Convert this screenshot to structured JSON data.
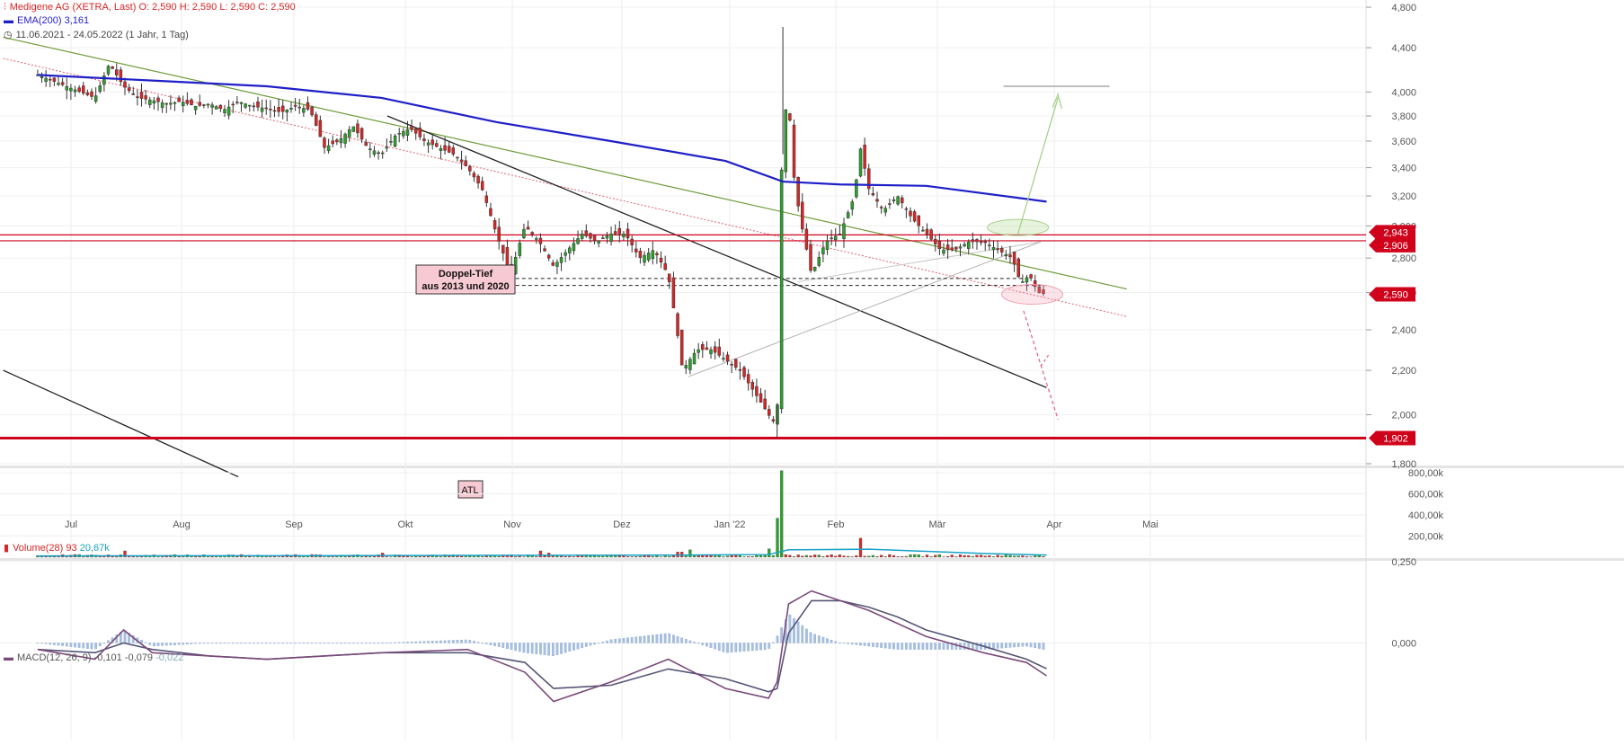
{
  "header": {
    "instrument": "Medigene AG (XETRA, Last)",
    "ohlc": "O: 2,590  H: 2,590  L: 2,590  C: 2,590",
    "ema_label": "EMA(200)",
    "ema_value": "3,161",
    "range": "11.06.2021 - 24.05.2022  (1 Jahr, 1 Tag)"
  },
  "volume_legend": {
    "label": "Volume(28)",
    "v1": "93",
    "v2": "20,67k"
  },
  "macd_legend": {
    "label": "MACD(12, 26, 9)",
    "v1": "-0,101",
    "v2": "-0,079",
    "v3": "-0,022"
  },
  "colors": {
    "up": "#2ca02c",
    "down": "#d62728",
    "ema": "#1f1fc8",
    "trend_green": "#6e9c3a",
    "black_line": "#222222",
    "red_level": "#d0021b",
    "macd": "#7a4a7a",
    "signal": "#555577",
    "hist": "#a8c0e0",
    "volume_ma": "#17a2c8"
  },
  "annotations": {
    "double_bottom_line1": "Doppel-Tief",
    "double_bottom_line2": "aus 2013 und 2020",
    "atl": "ATL"
  },
  "chart_data": [
    {
      "type": "candlestick",
      "title": "Medigene AG (XETRA, Last)",
      "x_months": [
        "Jul",
        "Aug",
        "Sep",
        "Okt",
        "Nov",
        "Dez",
        "Jan '22",
        "Feb",
        "Mär",
        "Apr",
        "Mai"
      ],
      "y_ticks": [
        "4,800",
        "4,400",
        "4,000",
        "3,800",
        "3,600",
        "3,400",
        "3,200",
        "3,000",
        "2,800",
        "2,600",
        "2,400",
        "2,200",
        "2,000",
        "1,800"
      ],
      "y_range": [
        1.8,
        4.8
      ],
      "y_scale": "log",
      "price_markers": [
        "2,943",
        "2,906",
        "2,590",
        "1,902"
      ],
      "support_levels": [
        2.943,
        2.906,
        1.902
      ],
      "close_path": [
        [
          0,
          4.15
        ],
        [
          5,
          4.1
        ],
        [
          10,
          4.05
        ],
        [
          15,
          4.0
        ],
        [
          20,
          3.95
        ],
        [
          25,
          4.25
        ],
        [
          30,
          4.05
        ],
        [
          35,
          3.95
        ],
        [
          40,
          3.93
        ],
        [
          45,
          3.9
        ],
        [
          50,
          3.92
        ],
        [
          55,
          3.88
        ],
        [
          60,
          3.9
        ],
        [
          65,
          3.85
        ],
        [
          70,
          3.92
        ],
        [
          75,
          3.88
        ],
        [
          80,
          3.86
        ],
        [
          85,
          3.83
        ],
        [
          90,
          3.88
        ],
        [
          95,
          3.85
        ],
        [
          100,
          3.55
        ],
        [
          105,
          3.6
        ],
        [
          110,
          3.72
        ],
        [
          115,
          3.55
        ],
        [
          120,
          3.5
        ],
        [
          125,
          3.65
        ],
        [
          130,
          3.7
        ],
        [
          135,
          3.6
        ],
        [
          140,
          3.55
        ],
        [
          145,
          3.5
        ],
        [
          150,
          3.4
        ],
        [
          155,
          3.25
        ],
        [
          160,
          2.95
        ],
        [
          165,
          2.7
        ],
        [
          170,
          3.0
        ],
        [
          175,
          2.9
        ],
        [
          180,
          2.75
        ],
        [
          185,
          2.85
        ],
        [
          190,
          2.95
        ],
        [
          195,
          2.9
        ],
        [
          200,
          2.95
        ],
        [
          205,
          2.95
        ],
        [
          210,
          2.8
        ],
        [
          215,
          2.85
        ],
        [
          220,
          2.7
        ],
        [
          225,
          2.2
        ],
        [
          230,
          2.3
        ],
        [
          235,
          2.3
        ],
        [
          240,
          2.25
        ],
        [
          245,
          2.2
        ],
        [
          250,
          2.1
        ],
        [
          255,
          2.0
        ],
        [
          258,
          1.95
        ],
        [
          260,
          3.8
        ],
        [
          262,
          3.9
        ],
        [
          264,
          3.3
        ],
        [
          266,
          3.05
        ],
        [
          270,
          2.7
        ],
        [
          275,
          2.9
        ],
        [
          280,
          2.95
        ],
        [
          285,
          3.2
        ],
        [
          287,
          3.55
        ],
        [
          290,
          3.25
        ],
        [
          295,
          3.1
        ],
        [
          300,
          3.2
        ],
        [
          305,
          3.05
        ],
        [
          310,
          2.95
        ],
        [
          315,
          2.85
        ],
        [
          320,
          2.85
        ],
        [
          325,
          2.9
        ],
        [
          330,
          2.9
        ],
        [
          335,
          2.85
        ],
        [
          340,
          2.8
        ],
        [
          343,
          2.65
        ],
        [
          346,
          2.7
        ],
        [
          349,
          2.6
        ],
        [
          352,
          2.59
        ]
      ],
      "ema200": [
        [
          0,
          4.15
        ],
        [
          40,
          4.1
        ],
        [
          80,
          4.05
        ],
        [
          120,
          3.95
        ],
        [
          160,
          3.75
        ],
        [
          200,
          3.6
        ],
        [
          240,
          3.45
        ],
        [
          260,
          3.3
        ],
        [
          280,
          3.28
        ],
        [
          310,
          3.27
        ],
        [
          352,
          3.161
        ]
      ],
      "volume_y_ticks": [
        "800,00k",
        "600,00k",
        "400,00k",
        "200,00k"
      ],
      "volume_range": [
        0,
        800
      ],
      "volume_spikes": [
        [
          30,
          60
        ],
        [
          120,
          40
        ],
        [
          175,
          60
        ],
        [
          178,
          40
        ],
        [
          224,
          50
        ],
        [
          228,
          70
        ],
        [
          255,
          80
        ],
        [
          258,
          370
        ],
        [
          259,
          820
        ],
        [
          260,
          720
        ],
        [
          287,
          180
        ]
      ],
      "macd_y_ticks": [
        "0,250",
        "0,000"
      ],
      "macd_range": [
        -0.3,
        0.25
      ],
      "macd": [
        [
          0,
          -0.02
        ],
        [
          20,
          -0.05
        ],
        [
          30,
          0.04
        ],
        [
          40,
          -0.03
        ],
        [
          60,
          -0.04
        ],
        [
          80,
          -0.05
        ],
        [
          100,
          -0.04
        ],
        [
          120,
          -0.03
        ],
        [
          150,
          -0.02
        ],
        [
          170,
          -0.09
        ],
        [
          180,
          -0.18
        ],
        [
          200,
          -0.12
        ],
        [
          220,
          -0.05
        ],
        [
          240,
          -0.14
        ],
        [
          255,
          -0.17
        ],
        [
          258,
          -0.12
        ],
        [
          262,
          0.12
        ],
        [
          270,
          0.16
        ],
        [
          280,
          0.13
        ],
        [
          290,
          0.1
        ],
        [
          300,
          0.06
        ],
        [
          310,
          0.02
        ],
        [
          330,
          -0.03
        ],
        [
          345,
          -0.06
        ],
        [
          352,
          -0.101
        ]
      ],
      "signal": [
        [
          0,
          -0.02
        ],
        [
          20,
          -0.03
        ],
        [
          30,
          0.0
        ],
        [
          40,
          -0.02
        ],
        [
          60,
          -0.04
        ],
        [
          80,
          -0.05
        ],
        [
          100,
          -0.04
        ],
        [
          120,
          -0.03
        ],
        [
          150,
          -0.03
        ],
        [
          170,
          -0.06
        ],
        [
          180,
          -0.14
        ],
        [
          200,
          -0.13
        ],
        [
          220,
          -0.08
        ],
        [
          240,
          -0.11
        ],
        [
          255,
          -0.15
        ],
        [
          258,
          -0.14
        ],
        [
          262,
          0.03
        ],
        [
          270,
          0.13
        ],
        [
          280,
          0.13
        ],
        [
          290,
          0.11
        ],
        [
          300,
          0.08
        ],
        [
          310,
          0.04
        ],
        [
          330,
          -0.01
        ],
        [
          345,
          -0.05
        ],
        [
          352,
          -0.079
        ]
      ]
    }
  ]
}
